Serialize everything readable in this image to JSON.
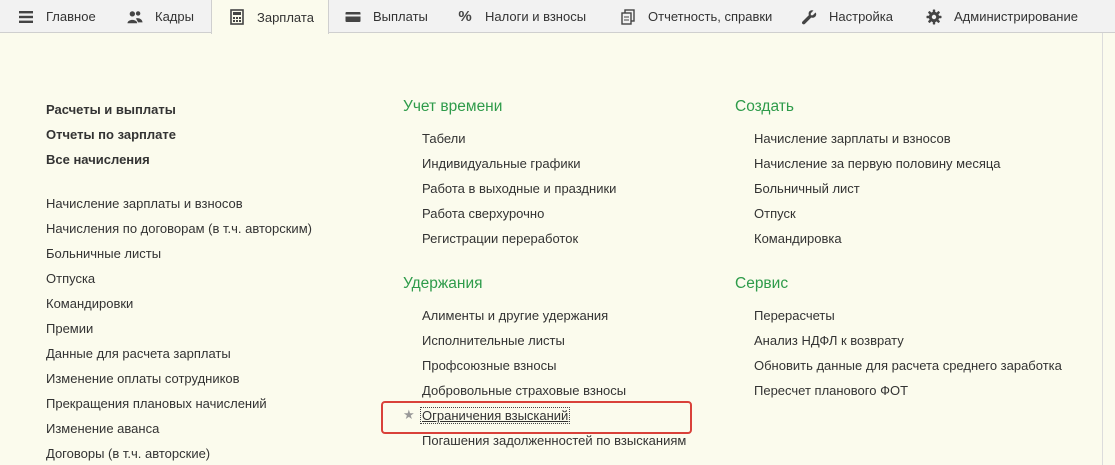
{
  "tabs": [
    {
      "label": "Главное",
      "icon": "menu-icon"
    },
    {
      "label": "Кадры",
      "icon": "users-icon"
    },
    {
      "label": "Зарплата",
      "icon": "calculator-icon",
      "active": true
    },
    {
      "label": "Выплаты",
      "icon": "wallet-icon"
    },
    {
      "label": "Налоги и взносы",
      "icon": "percent-icon"
    },
    {
      "label": "Отчетность, справки",
      "icon": "documents-icon"
    },
    {
      "label": "Настройка",
      "icon": "wrench-icon"
    },
    {
      "label": "Администрирование",
      "icon": "gear-icon"
    }
  ],
  "col1": {
    "bold_links": [
      "Расчеты и выплаты",
      "Отчеты по зарплате",
      "Все начисления"
    ],
    "links": [
      "Начисление зарплаты и взносов",
      "Начисления по договорам (в т.ч. авторским)",
      "Больничные листы",
      "Отпуска",
      "Командировки",
      "Премии",
      "Данные для расчета зарплаты",
      "Изменение оплаты сотрудников",
      "Прекращения плановых начислений",
      "Изменение аванса",
      "Договоры (в т.ч. авторские)"
    ]
  },
  "col2": {
    "time_heading": "Учет времени",
    "time_links": [
      "Табели",
      "Индивидуальные графики",
      "Работа в выходные и праздники",
      "Работа сверхурочно",
      "Регистрации переработок"
    ],
    "deductions_heading": "Удержания",
    "deductions_links": [
      "Алименты и другие удержания",
      "Исполнительные листы",
      "Профсоюзные взносы",
      "Добровольные страховые взносы",
      "Ограничения взысканий",
      "Погашения задолженностей по взысканиям"
    ]
  },
  "col3": {
    "create_heading": "Создать",
    "create_links": [
      "Начисление зарплаты и взносов",
      "Начисление за первую половину месяца",
      "Больничный лист",
      "Отпуск",
      "Командировка"
    ],
    "service_heading": "Сервис",
    "service_links": [
      "Перерасчеты",
      "Анализ НДФЛ к возврату",
      "Обновить данные для расчета среднего заработка",
      "Пересчет планового ФОТ"
    ]
  },
  "colors": {
    "heading": "#2e9b4a",
    "highlight": "#d9413a",
    "background": "#fbfbed"
  }
}
